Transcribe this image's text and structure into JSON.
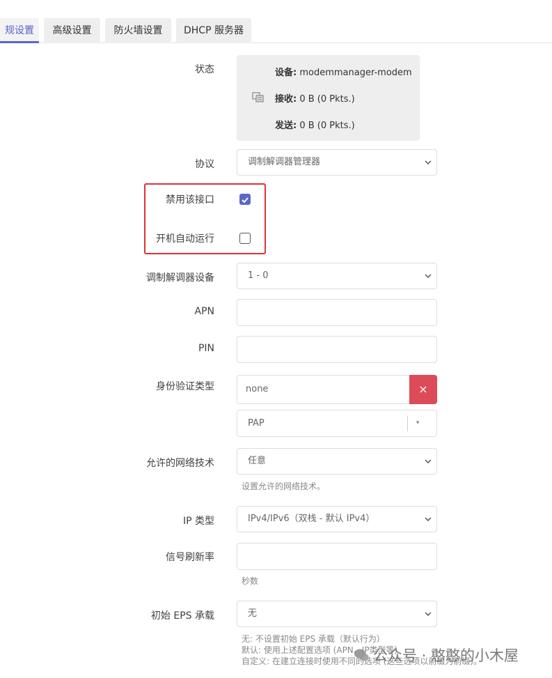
{
  "tabs": [
    {
      "label": "规设置",
      "active": true
    },
    {
      "label": "高级设置",
      "active": false
    },
    {
      "label": "防火墙设置",
      "active": false
    },
    {
      "label": "DHCP 服务器",
      "active": false
    }
  ],
  "status": {
    "label": "状态",
    "device_key": "设备:",
    "device_value": "modemmanager-modem",
    "rx_key": "接收:",
    "rx_value": "0 B (0 Pkts.)",
    "tx_key": "发送:",
    "tx_value": "0 B (0 Pkts.)",
    "icon": "network-interface-icon"
  },
  "protocol": {
    "label": "协议",
    "value": "调制解调器管理器"
  },
  "disable_interface": {
    "label": "禁用该接口",
    "checked": true
  },
  "autostart": {
    "label": "开机自动运行",
    "checked": false
  },
  "modem_device": {
    "label": "调制解调器设备",
    "value": "1 - 0"
  },
  "apn": {
    "label": "APN",
    "value": ""
  },
  "pin": {
    "label": "PIN",
    "value": ""
  },
  "auth": {
    "label": "身份验证类型",
    "selected_tag": "none",
    "remove_symbol": "×",
    "combo_value": "PAP",
    "combo_caret": "▾"
  },
  "allowed_tech": {
    "label": "允许的网络技术",
    "value": "任意",
    "hint": "设置允许的网络技术。"
  },
  "ip_type": {
    "label": "IP 类型",
    "value": "IPv4/IPv6（双栈 - 默认 IPv4）"
  },
  "signal_refresh": {
    "label": "信号刷新率",
    "value": "",
    "hint": "秒数"
  },
  "initial_eps": {
    "label": "初始 EPS 承载",
    "value": "无",
    "hint_lines": [
      "无: 不设置初始 EPS 承载（默认行为）",
      "默认: 使用上述配置选项 (APN、IP类型等)",
      "自定义: 在建立连接时使用不同的选项 (这些选项以前缀为前缀)。"
    ]
  },
  "watermark": {
    "text": "公众号 · 憨憨的小木屋"
  },
  "colors": {
    "accent": "#5b67cc",
    "danger": "#dc4c58",
    "highlight_box": "#e03131"
  }
}
